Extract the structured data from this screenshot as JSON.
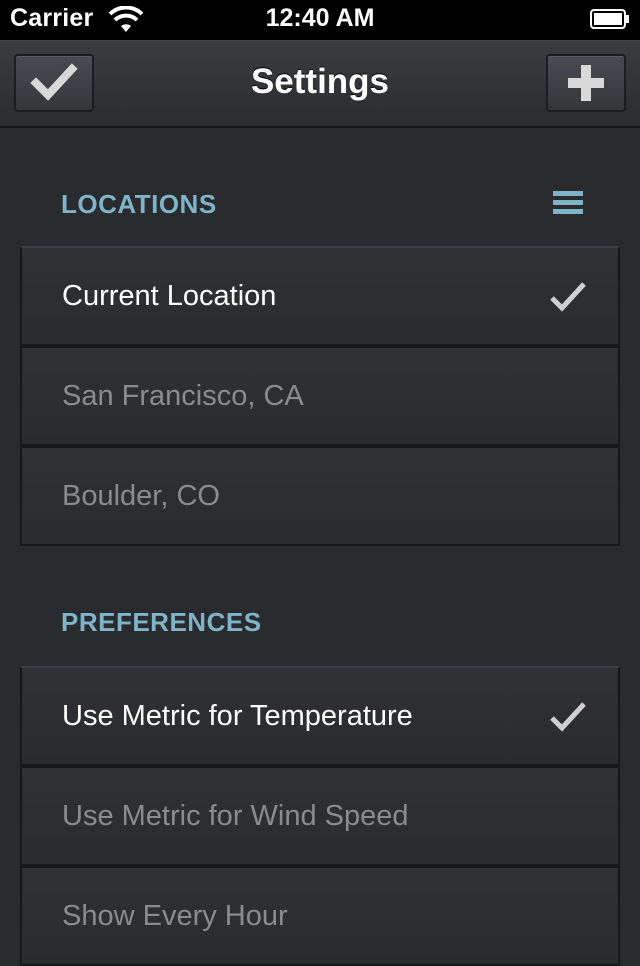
{
  "status_bar": {
    "carrier": "Carrier",
    "time": "12:40 AM"
  },
  "nav_bar": {
    "title": "Settings",
    "left_icon": "checkmark-icon",
    "right_icon": "plus-icon"
  },
  "sections": {
    "locations": {
      "header": "LOCATIONS",
      "items": [
        {
          "label": "Current Location",
          "selected": true
        },
        {
          "label": "San Francisco, CA",
          "selected": false
        },
        {
          "label": "Boulder, CO",
          "selected": false
        }
      ]
    },
    "preferences": {
      "header": "PREFERENCES",
      "items": [
        {
          "label": "Use Metric for Temperature",
          "selected": true
        },
        {
          "label": "Use Metric for Wind Speed",
          "selected": false
        },
        {
          "label": "Show Every Hour",
          "selected": false
        }
      ]
    }
  },
  "colors": {
    "accent": "#7fb3c8",
    "background": "#2a2b2f",
    "selected_text": "#ffffff",
    "unselected_text": "#8a8b8f"
  }
}
